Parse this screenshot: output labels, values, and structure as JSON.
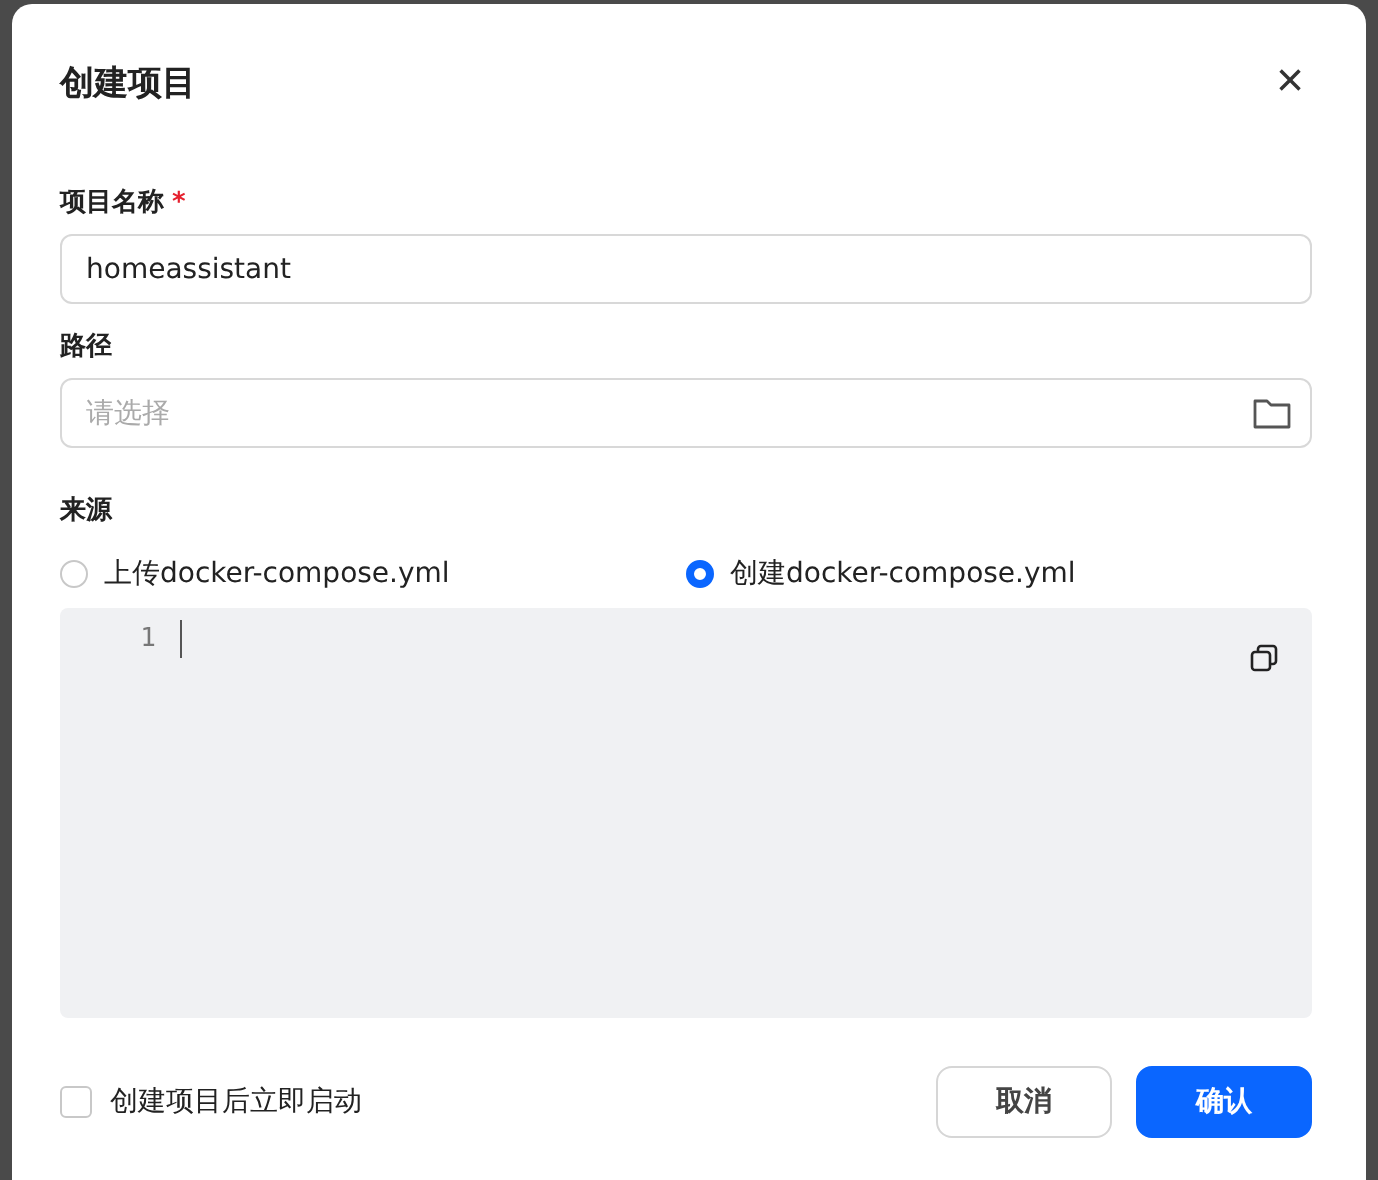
{
  "dialog": {
    "title": "创建项目",
    "close": "×"
  },
  "name_field": {
    "label": "项目名称",
    "required_mark": "*",
    "value": "homeassistant"
  },
  "path_field": {
    "label": "路径",
    "placeholder": "请选择"
  },
  "source": {
    "label": "来源",
    "options": [
      {
        "label": "上传docker-compose.yml",
        "selected": false
      },
      {
        "label": "创建docker-compose.yml",
        "selected": true
      }
    ]
  },
  "editor": {
    "line_numbers": [
      "1"
    ]
  },
  "start_after_create": {
    "label": "创建项目后立即启动",
    "checked": false
  },
  "buttons": [
    {
      "label": "取消",
      "kind": "secondary"
    },
    {
      "label": "确认",
      "kind": "primary"
    }
  ]
}
